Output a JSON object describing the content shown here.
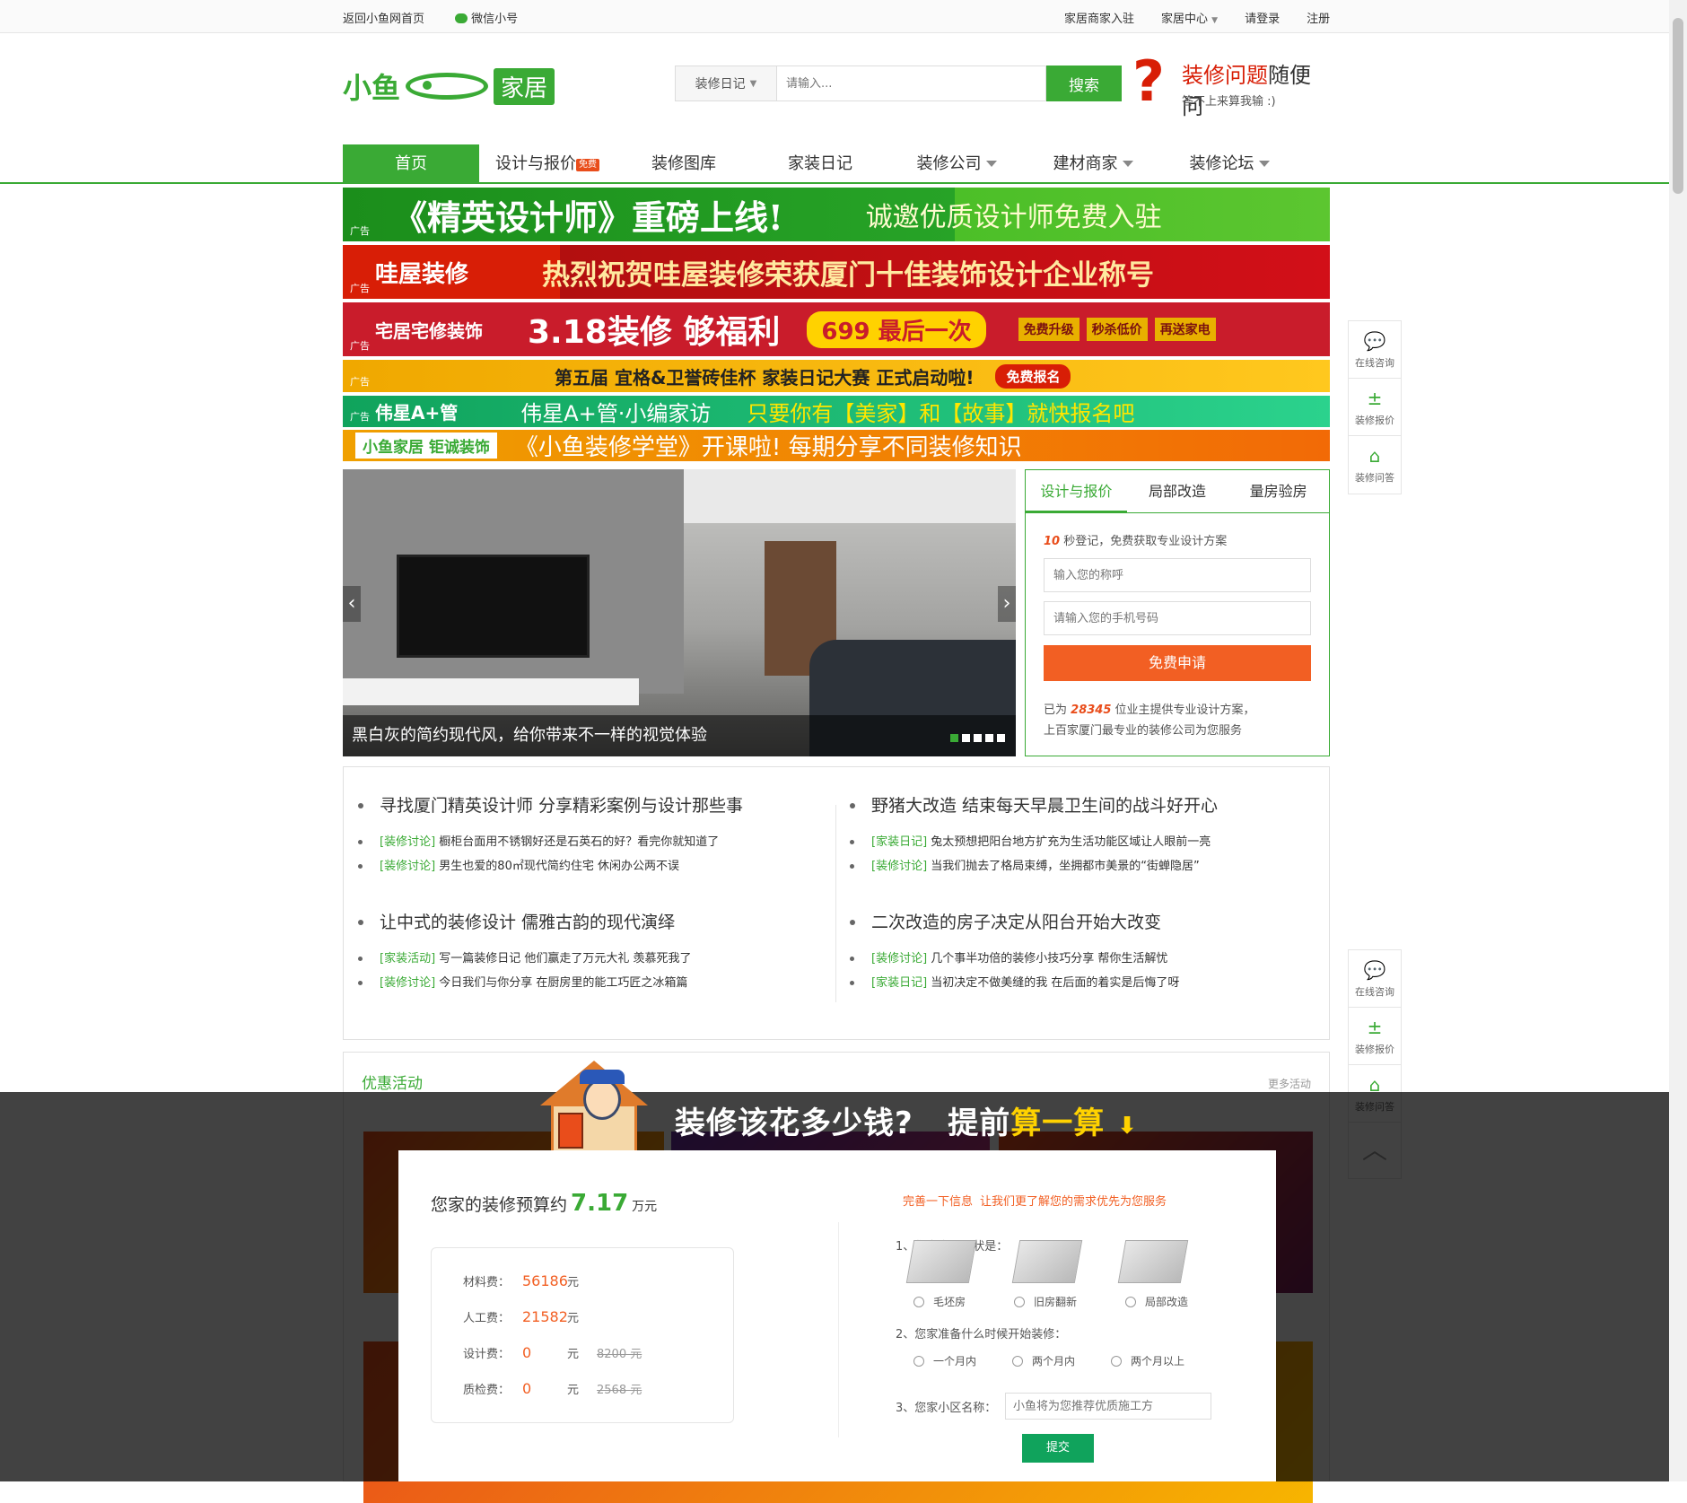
{
  "topbar": {
    "home": "返回小鱼网首页",
    "wechat": "微信小号",
    "merchant": "家居商家入驻",
    "center": "家居中心",
    "login": "请登录",
    "register": "注册"
  },
  "logo": {
    "brand": "小鱼",
    "sub": "家居"
  },
  "search": {
    "select": "装修日记",
    "placeholder": "请输入...",
    "button": "搜索"
  },
  "ask": {
    "q": "?",
    "title_red": "装修问题",
    "title_rest": "随便问",
    "subtitle": "答不上来算我输 :)"
  },
  "nav": [
    {
      "label": "首页"
    },
    {
      "label": "设计与报价",
      "badge": "免费"
    },
    {
      "label": "装修图库"
    },
    {
      "label": "家装日记"
    },
    {
      "label": "装修公司"
    },
    {
      "label": "建材商家"
    },
    {
      "label": "装修论坛"
    }
  ],
  "ads": {
    "tag": "广告",
    "ad1": {
      "left": "《精英设计师》重磅上线!",
      "right": "诚邀优质设计师免费入驻"
    },
    "ad2": {
      "brand": "哇屋装修",
      "text": "热烈祝贺哇屋装修荣获厦门十佳装饰设计企业称号"
    },
    "ad3": {
      "brand": "宅居宅修装饰",
      "text": "3.18装修 够福利",
      "price": "699 最后一次",
      "b1": "免费升级",
      "b2": "秒杀低价",
      "b3": "再送家电"
    },
    "ad4": {
      "text": "第五届 宜格&卫誉砖佳杯 家装日记大赛 正式启动啦!",
      "btn": "免费报名"
    },
    "ad5": {
      "brand": "伟星A+管",
      "text": "伟星A+管·小编家访",
      "cta": "只要你有【美家】和【故事】就快报名吧"
    },
    "ad6": {
      "brand": "小鱼家居 钜诚装饰",
      "text": "《小鱼装修学堂》开课啦! 每期分享不同装修知识"
    }
  },
  "slider": {
    "caption": "黑白灰的简约现代风，给你带来不一样的视觉体验",
    "prev": "‹",
    "next": "›"
  },
  "form": {
    "tabs": [
      "设计与报价",
      "局部改造",
      "量房验房"
    ],
    "lead_num": "10",
    "lead": "秒登记，免费获取专业设计方案",
    "name_ph": "输入您的称呼",
    "phone_ph": "请输入您的手机号码",
    "apply": "免费申请",
    "note1a": "已为",
    "note_num": "28345",
    "note1b": "位业主提供专业设计方案，",
    "note2": "上百家厦门最专业的装修公司为您服务"
  },
  "news": {
    "left": [
      {
        "title": "寻找厦门精英设计师 分享精彩案例与设计那些事",
        "items": [
          {
            "cat": "[装修讨论]",
            "text": "橱柜台面用不锈钢好还是石英石的好？看完你就知道了"
          },
          {
            "cat": "[装修讨论]",
            "text": "男生也爱的80㎡现代简约住宅 休闲办公两不误"
          }
        ]
      },
      {
        "title": "让中式的装修设计 儒雅古韵的现代演绎",
        "items": [
          {
            "cat": "[家装活动]",
            "text": "写一篇装修日记 他们赢走了万元大礼 羡慕死我了"
          },
          {
            "cat": "[装修讨论]",
            "text": "今日我们与你分享 在厨房里的能工巧匠之冰箱篇"
          }
        ]
      }
    ],
    "right": [
      {
        "title": "野猪大改造 结束每天早晨卫生间的战斗好开心",
        "items": [
          {
            "cat": "[家装日记]",
            "text": "兔太预想把阳台地方扩充为生活功能区域让人眼前一亮"
          },
          {
            "cat": "[装修讨论]",
            "text": "当我们抛去了格局束缚，坐拥都市美景的“街蝉隐居”"
          }
        ]
      },
      {
        "title": "二次改造的房子决定从阳台开始大改变",
        "items": [
          {
            "cat": "[装修讨论]",
            "text": "几个事半功倍的装修小技巧分享 帮你生活解忧"
          },
          {
            "cat": "[家装日记]",
            "text": "当初决定不做美缝的我 在后面的着实是后悔了呀"
          }
        ]
      }
    ]
  },
  "promo": {
    "title": "优惠活动",
    "more": "更多活动"
  },
  "side": {
    "consult": "在线咨询",
    "quote": "装修报价",
    "qa": "装修问答",
    "up": "︿"
  },
  "calc": {
    "title_a": "装修该花多少钱?",
    "title_b": "提前",
    "title_c": "算一算",
    "arrow": "⬇",
    "budget_pre": "您家的装修预算约",
    "budget": "7.17",
    "budget_unit": "万元",
    "rows": [
      {
        "label": "材料费：",
        "val": "56186",
        "unit": "元",
        "old": ""
      },
      {
        "label": "人工费：",
        "val": "21582",
        "unit": "元",
        "old": ""
      },
      {
        "label": "设计费：",
        "val": "0",
        "unit": "元",
        "old": "8200 元"
      },
      {
        "label": "质检费：",
        "val": "0",
        "unit": "元",
        "old": "2568 元"
      }
    ],
    "info_title": "完善一下信息",
    "info_sub": "让我们更了解您的需求优先为您服务",
    "q1": "1、您家房屋现状是：",
    "q1_opts": [
      "毛坯房",
      "旧房翻新",
      "局部改造"
    ],
    "q2": "2、您家准备什么时候开始装修：",
    "q2_opts": [
      "一个月内",
      "两个月内",
      "两个月以上"
    ],
    "q3": "3、您家小区名称：",
    "q3_ph": "小鱼将为您推荐优质施工方",
    "submit": "提交"
  }
}
